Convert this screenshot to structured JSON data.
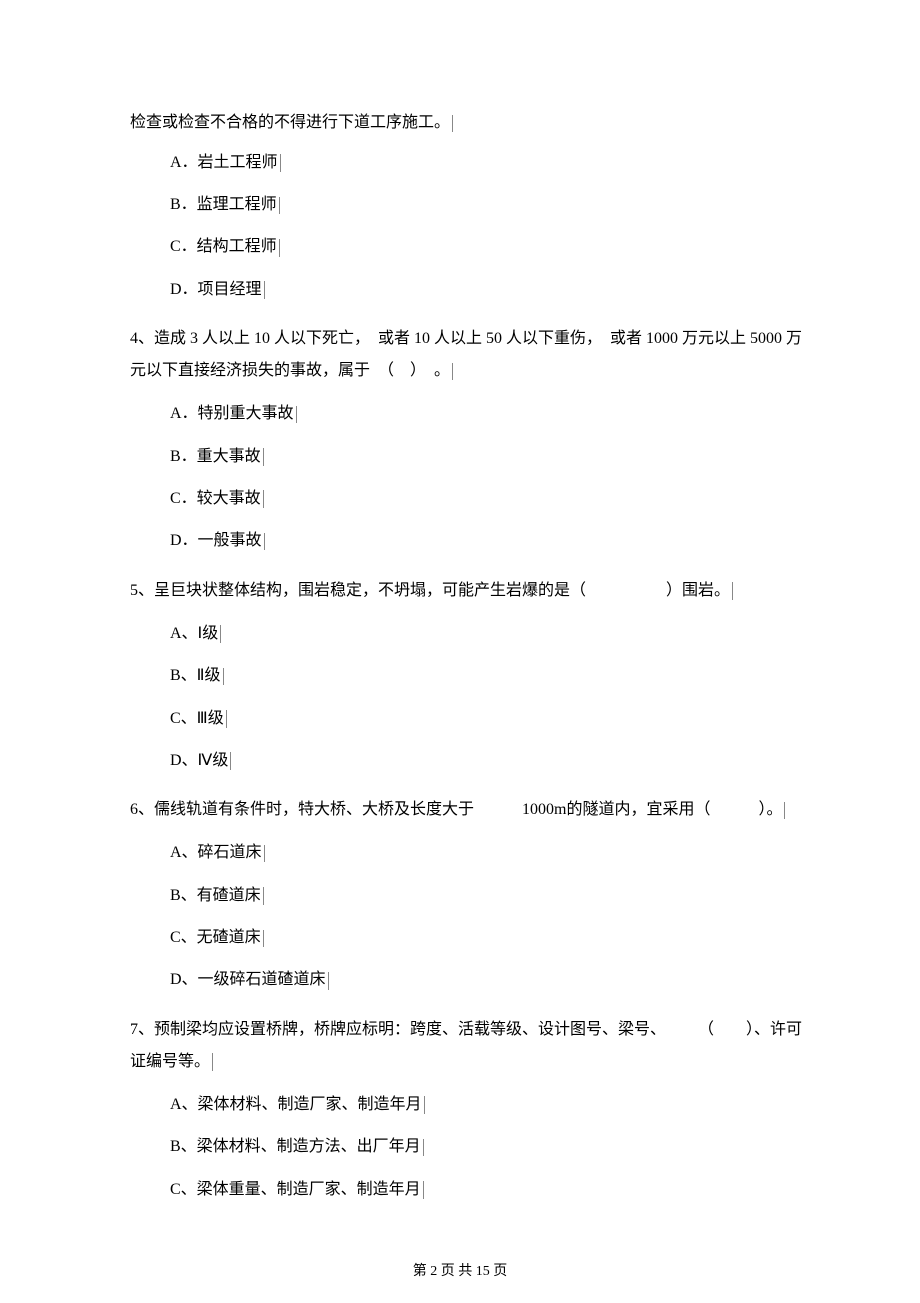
{
  "top_fragment": "检查或检查不合格的不得进行下道工序施工。",
  "q3_options": {
    "a": "A．岩土工程师",
    "b": "B．监理工程师",
    "c": "C．结构工程师",
    "d": "D．项目经理"
  },
  "q4_stem": "4、造成 3 人以上 10 人以下死亡，　或者 10 人以上 50 人以下重伤，　或者 1000 万元以上 5000 万元以下直接经济损失的事故，属于　（　）　。",
  "q4_options": {
    "a": "A．特别重大事故",
    "b": "B．重大事故",
    "c": "C．较大事故",
    "d": "D．一般事故"
  },
  "q5_stem": "5、呈巨块状整体结构，围岩稳定，不坍塌，可能产生岩爆的是（　　　　　）围岩。",
  "q5_options": {
    "a": "A、Ⅰ级",
    "b": "B、Ⅱ级",
    "c": "C、Ⅲ级",
    "d": "D、Ⅳ级"
  },
  "q6_stem": "6、儒线轨道有条件时，特大桥、大桥及长度大于　　　1000m的隧道内，宜采用（　　　）。",
  "q6_options": {
    "a": "A、碎石道床",
    "b": "B、有碴道床",
    "c": "C、无碴道床",
    "d": "D、一级碎石道碴道床"
  },
  "q7_stem": "7、预制梁均应设置桥牌，桥牌应标明：跨度、活载等级、设计图号、梁号、　　　（　　）、许可证编号等。",
  "q7_options": {
    "a": "A、梁体材料、制造厂家、制造年月",
    "b": "B、梁体材料、制造方法、出厂年月",
    "c": "C、梁体重量、制造厂家、制造年月"
  },
  "footer": "第 2 页 共 15 页"
}
